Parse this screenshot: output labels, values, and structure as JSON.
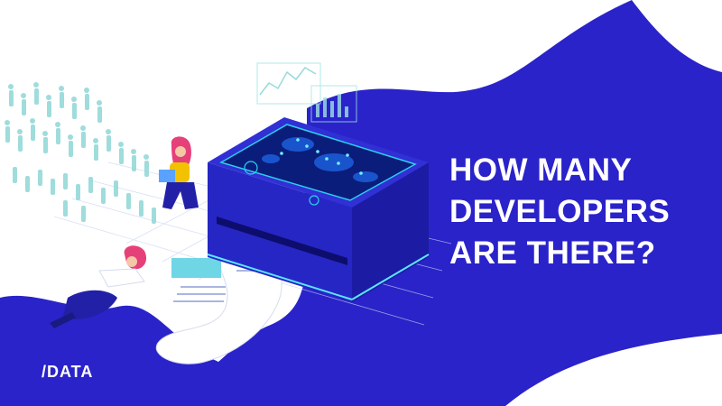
{
  "headline": {
    "line1": "HOW MANY",
    "line2": "DEVELOPERS",
    "line3": "ARE THERE?"
  },
  "logo": {
    "text": "/DATA"
  },
  "colors": {
    "background": "#ffffff",
    "accent_blue": "#2a23c9",
    "device_side": "#1f1fb8",
    "screen": "#0b1d7a",
    "crowd": "#8fd6d6",
    "headline_text": "#ffffff"
  }
}
